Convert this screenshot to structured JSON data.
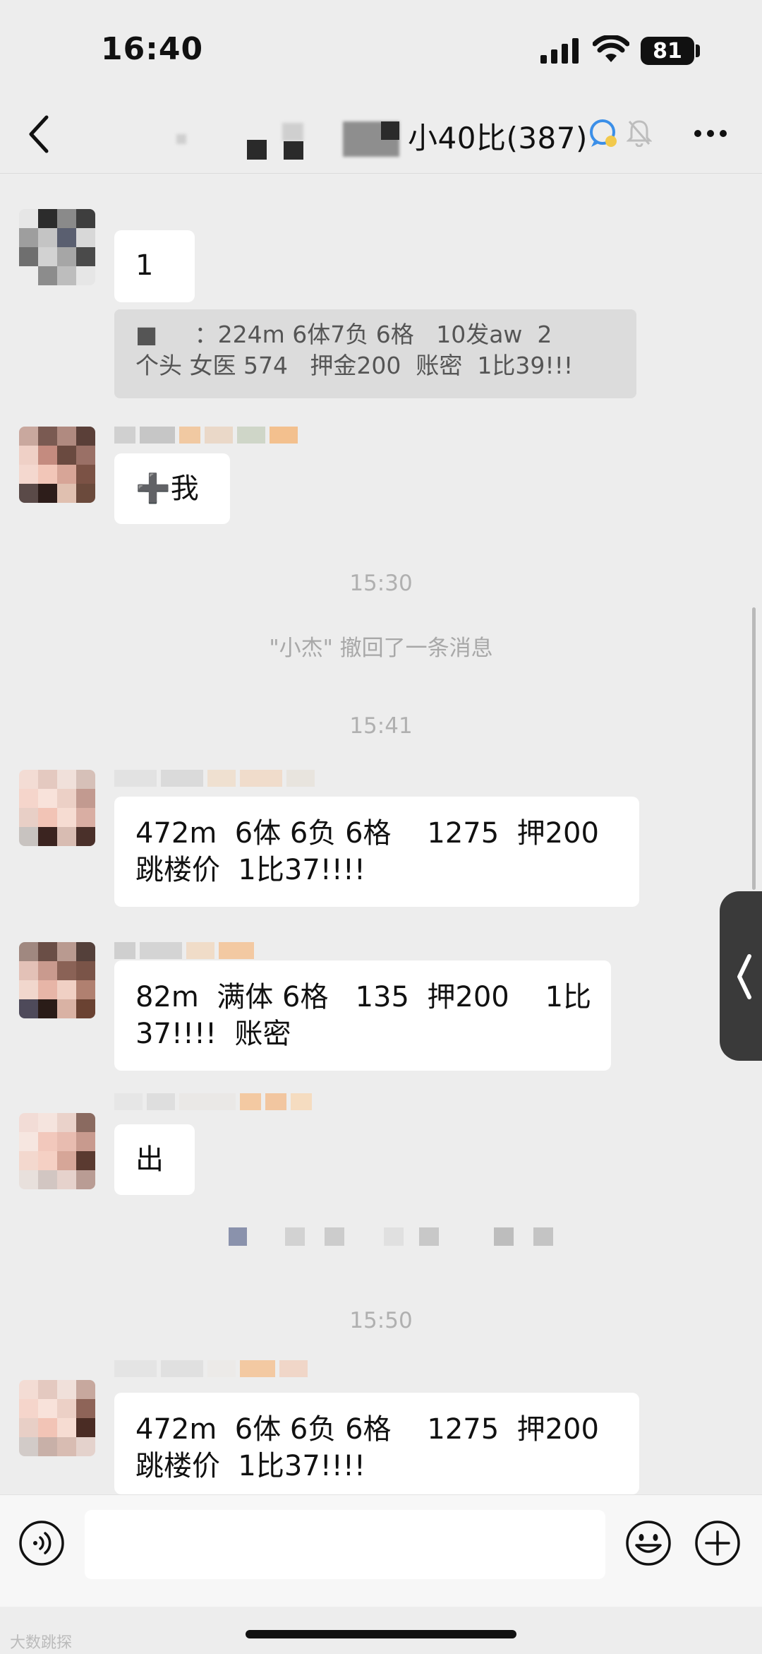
{
  "status_bar": {
    "time": "16:40",
    "battery": "81"
  },
  "header": {
    "title_visible": "小40比(387)"
  },
  "messages": {
    "m1": {
      "text": "1"
    },
    "quote": {
      "line1": "■     ：224m 6体7负 6格   10发aw  2",
      "line2": "个头 女医 574   押金200  账密  1比39!!!"
    },
    "m2": {
      "text": "➕我"
    },
    "ts1": "15:30",
    "recall": "\"小杰\" 撤回了一条消息",
    "ts2": "15:41",
    "m3": {
      "line1": "472m  6体 6负 6格    1275  押200",
      "line2": "跳楼价  1比37!!!!"
    },
    "m4": {
      "line1": "82m  满体 6格   135  押200    1比",
      "line2": "37!!!!  账密"
    },
    "m5": {
      "text": "出"
    },
    "ts3": "15:50",
    "m6": {
      "line1": "472m  6体 6负 6格    1275  押200",
      "line2": "跳楼价  1比37!!!!"
    }
  },
  "watermark": "大数跳探"
}
